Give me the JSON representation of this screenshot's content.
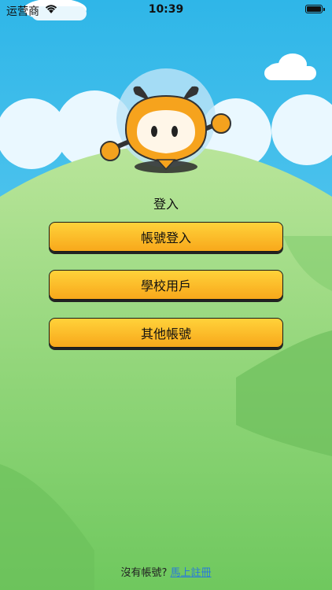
{
  "status_bar": {
    "carrier": "运营商",
    "time": "10:39"
  },
  "login": {
    "title": "登入",
    "buttons": [
      "帳號登入",
      "學校用戶",
      "其他帳號"
    ]
  },
  "footer": {
    "prompt": "沒有帳號?",
    "link": "馬上註冊"
  },
  "colors": {
    "button_top": "#FFD23A",
    "button_bottom": "#F8A81B",
    "link": "#2a7ad9",
    "sky": "#39BFEA",
    "hill": "#7BCB67"
  }
}
